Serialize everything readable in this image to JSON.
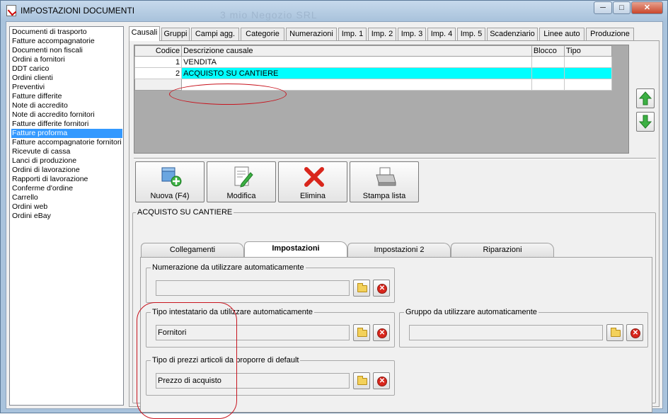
{
  "window": {
    "title": "IMPOSTAZIONI DOCUMENTI",
    "watermark": "3 mio Negozio SRL",
    "buttons": {
      "minimize": "─",
      "maximize": "□",
      "close": "✕"
    }
  },
  "sidebar": {
    "items": [
      {
        "label": "Documenti di trasporto"
      },
      {
        "label": "Fatture accompagnatorie"
      },
      {
        "label": "Documenti non fiscali"
      },
      {
        "label": "Ordini a fornitori"
      },
      {
        "label": "DDT carico"
      },
      {
        "label": "Ordini clienti"
      },
      {
        "label": "Preventivi"
      },
      {
        "label": "Fatture differite"
      },
      {
        "label": "Note di accredito"
      },
      {
        "label": "Note di accredito fornitori"
      },
      {
        "label": "Fatture differite fornitori"
      },
      {
        "label": "Fatture proforma"
      },
      {
        "label": "Fatture accompagnatorie fornitori"
      },
      {
        "label": "Ricevute di cassa"
      },
      {
        "label": "Lanci di produzione"
      },
      {
        "label": "Ordini di lavorazione"
      },
      {
        "label": "Rapporti di lavorazione"
      },
      {
        "label": "Conferme d'ordine"
      },
      {
        "label": "Carrello"
      },
      {
        "label": "Ordini web"
      },
      {
        "label": "Ordini eBay"
      }
    ],
    "selected": "Fatture proforma"
  },
  "tabs": [
    "Causali",
    "Gruppi",
    "Campi agg.",
    "Categorie",
    "Numerazioni",
    "Imp. 1",
    "Imp. 2",
    "Imp. 3",
    "Imp. 4",
    "Imp. 5",
    "Scadenziario",
    "Linee auto",
    "Produzione"
  ],
  "active_tab": "Causali",
  "grid": {
    "columns": [
      "Codice",
      "Descrizione causale",
      "Blocco",
      "Tipo"
    ],
    "rows": [
      {
        "codice": "1",
        "descrizione": "VENDITA",
        "blocco": "",
        "tipo": ""
      },
      {
        "codice": "2",
        "descrizione": "ACQUISTO SU CANTIERE",
        "blocco": "",
        "tipo": ""
      }
    ],
    "selected_row": 1
  },
  "toolbar": {
    "nuova": "Nuova (F4)",
    "modifica": "Modifica",
    "elimina": "Elimina",
    "stampa": "Stampa lista"
  },
  "detail": {
    "title": "ACQUISTO SU CANTIERE",
    "subtabs": [
      "Collegamenti",
      "Impostazioni",
      "Impostazioni 2",
      "Riparazioni"
    ],
    "active_subtab": "Impostazioni",
    "numerazione": {
      "label": "Numerazione da utilizzare automaticamente",
      "value": ""
    },
    "intestatario": {
      "label": "Tipo intestatario da utilizzare automaticamente",
      "value": "Fornitori"
    },
    "gruppo": {
      "label": "Gruppo da utilizzare automaticamente",
      "value": ""
    },
    "prezzi": {
      "label": "Tipo di prezzi articoli da proporre di default",
      "value": "Prezzo di acquisto"
    }
  },
  "colors": {
    "selection": "#3399ff",
    "grid_selection": "#00ffff",
    "annotation": "#c8141e"
  }
}
